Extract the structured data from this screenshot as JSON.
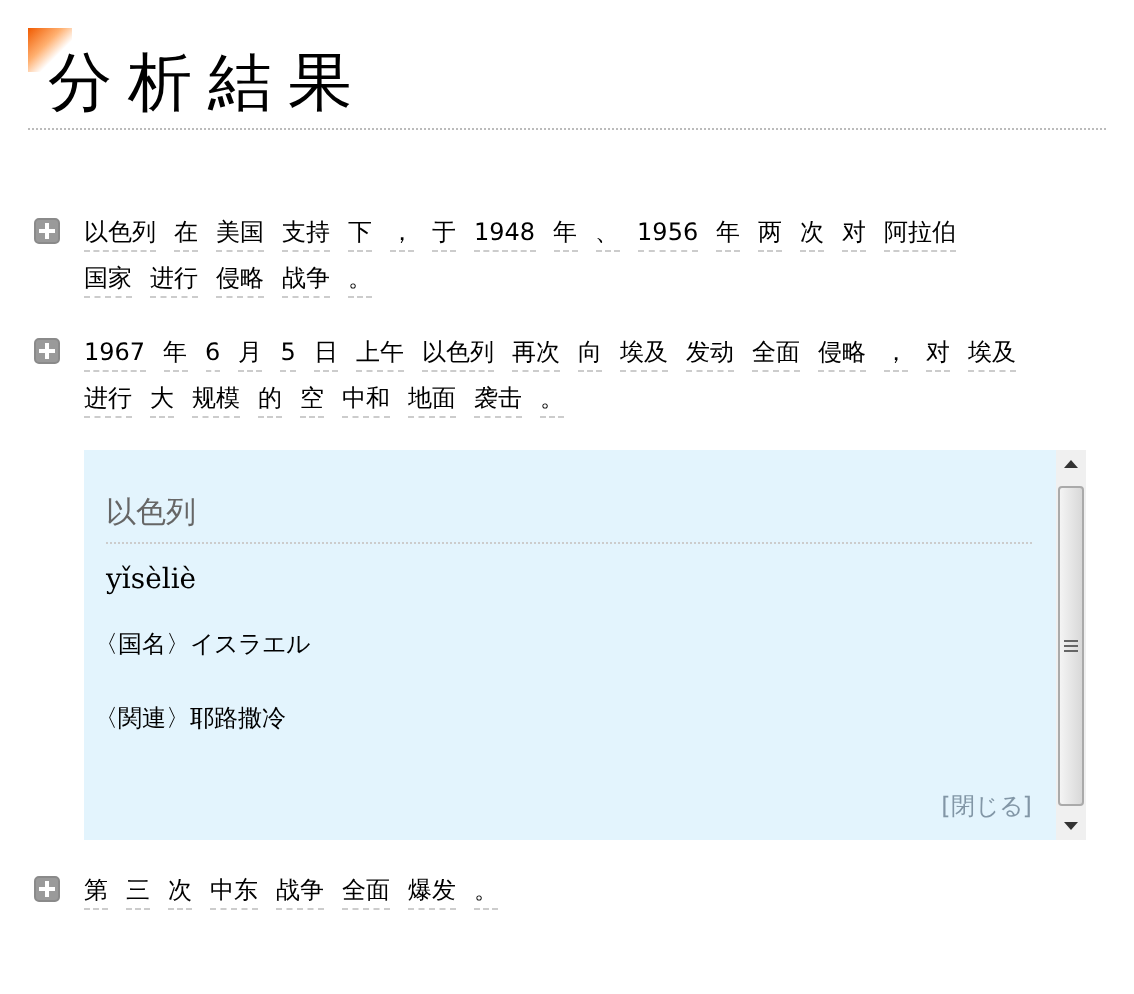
{
  "title": "分析結果",
  "sentences": [
    {
      "tokens": [
        "以色列",
        "在",
        "美国",
        "支持",
        "下",
        "，",
        "于",
        "1948",
        "年",
        "、",
        "1956",
        "年",
        "两",
        "次",
        "对",
        "阿拉伯",
        "国家",
        "进行",
        "侵略",
        "战争",
        "。"
      ]
    },
    {
      "tokens": [
        "1967",
        "年",
        "6",
        "月",
        "5",
        "日",
        "上午",
        "以色列",
        "再次",
        "向",
        "埃及",
        "发动",
        "全面",
        "侵略",
        "，",
        "对",
        "埃及",
        "进行",
        "大",
        "规模",
        "的",
        "空",
        "中和",
        "地面",
        "袭击",
        "。"
      ],
      "popup": {
        "headword": "以色列",
        "pinyin": "yǐsèliè",
        "definitions": [
          "〈国名〉イスラエル",
          "〈関連〉耶路撒冷"
        ],
        "close_label": "[閉じる]"
      }
    },
    {
      "tokens": [
        "第",
        "三",
        "次",
        "中东",
        "战争",
        "全面",
        "爆发",
        "。"
      ]
    }
  ]
}
